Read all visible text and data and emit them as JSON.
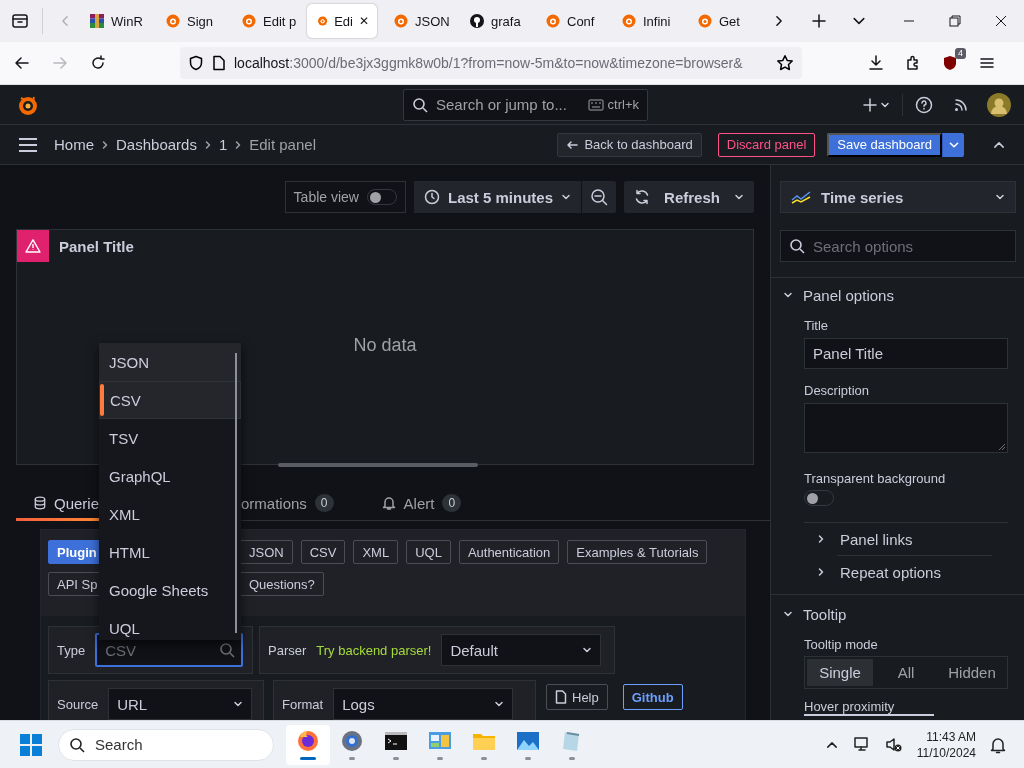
{
  "browser": {
    "tabs": [
      {
        "kind": "archive",
        "title": "WinR",
        "selected": false
      },
      {
        "kind": "grafana",
        "title": "Sign",
        "selected": false
      },
      {
        "kind": "grafana",
        "title": "Edit p",
        "selected": false
      },
      {
        "kind": "grafana",
        "title": "Edi",
        "selected": true,
        "close": "✕"
      },
      {
        "kind": "grafana",
        "title": "JSON",
        "selected": false
      },
      {
        "kind": "github",
        "title": "grafa",
        "selected": false
      },
      {
        "kind": "grafana",
        "title": "Conf",
        "selected": false
      },
      {
        "kind": "grafana",
        "title": "Infini",
        "selected": false
      },
      {
        "kind": "grafana",
        "title": "Get",
        "selected": false
      }
    ],
    "forward_disabled": true,
    "url": {
      "host": "localhost",
      "rest": ":3000/d/be3jx3ggmk8w0b/1?from=now-5m&to=now&timezone=browser&"
    },
    "extension_badge": "4"
  },
  "grafana": {
    "search_placeholder": "Search or jump to...",
    "shortcut": "ctrl+k",
    "breadcrumbs": [
      "Home",
      "Dashboards",
      "1",
      "Edit panel"
    ],
    "back_label": "Back to dashboard",
    "discard_label": "Discard panel",
    "save_label": "Save dashboard"
  },
  "toolbar": {
    "table_view": {
      "label": "Table view",
      "on": false
    },
    "time_range": "Last 5 minutes",
    "refresh": "Refresh"
  },
  "panel": {
    "title": "Panel Title",
    "error": true,
    "message": "No data"
  },
  "query_tabs": [
    {
      "kind": "queries",
      "label": "Querie",
      "selected": true
    },
    {
      "kind": "transformations",
      "label": "ormations",
      "count": "0",
      "selected": false
    },
    {
      "kind": "alert",
      "label": "Alert",
      "count": "0",
      "selected": false
    }
  ],
  "plugin_links": [
    [
      {
        "label": "Plugin",
        "primary": true
      },
      {
        "label": "JSON",
        "primary": false
      },
      {
        "label": "CSV",
        "primary": false
      },
      {
        "label": "XML",
        "primary": false
      },
      {
        "label": "UQL",
        "primary": false
      },
      {
        "label": "Authentication",
        "primary": false
      },
      {
        "label": "Examples & Tutorials",
        "primary": false
      }
    ],
    [
      {
        "label": "API Sp",
        "primary": false
      },
      {
        "label": "Questions?",
        "primary": false
      }
    ]
  ],
  "query": {
    "type": {
      "label": "Type",
      "placeholder": "CSV",
      "focused": true
    },
    "parser": {
      "label": "Parser",
      "hint": "Try backend parser!",
      "value": "Default"
    },
    "source": {
      "label": "Source",
      "value": "URL"
    },
    "format": {
      "label": "Format",
      "value": "Logs"
    },
    "help": "Help",
    "github": "Github"
  },
  "type_dropdown": {
    "options": [
      {
        "label": "JSON",
        "selected": false,
        "hovered": true
      },
      {
        "label": "CSV",
        "selected": true,
        "hovered": false
      },
      {
        "label": "TSV",
        "selected": false,
        "hovered": false
      },
      {
        "label": "GraphQL",
        "selected": false,
        "hovered": false
      },
      {
        "label": "XML",
        "selected": false,
        "hovered": false
      },
      {
        "label": "HTML",
        "selected": false,
        "hovered": false
      },
      {
        "label": "Google Sheets",
        "selected": false,
        "hovered": false
      },
      {
        "label": "UQL",
        "selected": false,
        "hovered": false
      }
    ]
  },
  "options_pane": {
    "visualization": "Time series",
    "search_placeholder": "Search options",
    "panel_options": {
      "title": "Panel options",
      "expanded": true,
      "title_label": "Title",
      "title_value": "Panel Title",
      "description_label": "Description",
      "transparent_label": "Transparent background",
      "transparent_on": false,
      "subsections": [
        {
          "title": "Panel links",
          "expanded": false
        },
        {
          "title": "Repeat options",
          "expanded": false
        }
      ]
    },
    "tooltip": {
      "title": "Tooltip",
      "expanded": true,
      "mode_label": "Tooltip mode",
      "modes": [
        {
          "label": "Single",
          "selected": true
        },
        {
          "label": "All",
          "selected": false
        },
        {
          "label": "Hidden",
          "selected": false
        }
      ],
      "next_label": "Hover proximity"
    }
  },
  "taskbar": {
    "search_placeholder": "Search",
    "apps": [
      {
        "kind": "browser",
        "active": true
      },
      {
        "kind": "gear",
        "active": false
      },
      {
        "kind": "terminal",
        "active": false
      },
      {
        "kind": "control",
        "active": false
      },
      {
        "kind": "folder",
        "active": false
      },
      {
        "kind": "photos",
        "active": false
      },
      {
        "kind": "notepad",
        "active": false
      }
    ],
    "time": "11:43 AM",
    "date": "11/10/2024"
  }
}
